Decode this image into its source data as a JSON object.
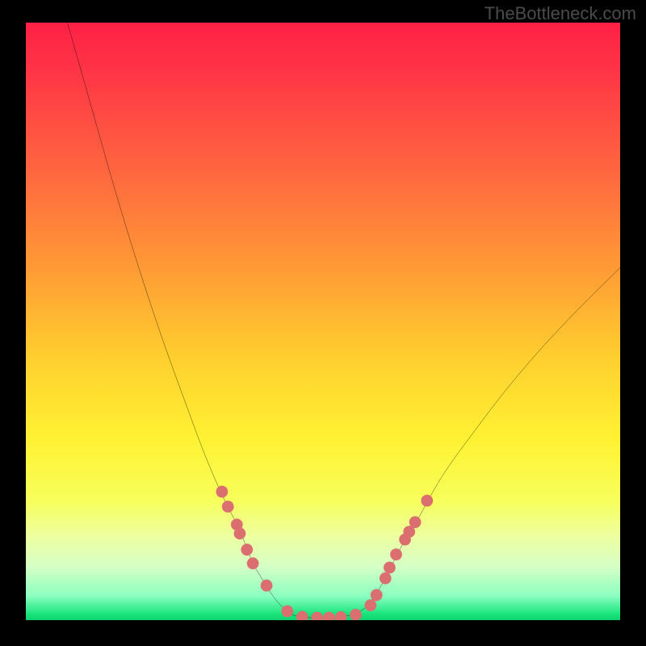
{
  "watermark": "TheBottleneck.com",
  "chart_data": {
    "type": "line",
    "title": "",
    "xlabel": "",
    "ylabel": "",
    "xlim": [
      0,
      100
    ],
    "ylim": [
      0,
      100
    ],
    "grid": false,
    "legend": false,
    "series": [
      {
        "name": "bottleneck-curve",
        "color": "#000000",
        "x": [
          7,
          11,
          15,
          19,
          23,
          27,
          30,
          33,
          36,
          38,
          40,
          42,
          44,
          46,
          50,
          54,
          57,
          59,
          61,
          63,
          66,
          70,
          75,
          82,
          90,
          100
        ],
        "y": [
          100,
          86,
          72,
          59,
          47,
          36,
          28,
          21,
          15,
          10,
          6.5,
          3.5,
          1.5,
          0.6,
          0.4,
          0.7,
          2,
          4.5,
          8,
          12,
          17,
          24,
          31,
          40,
          49,
          59
        ]
      }
    ],
    "markers": [
      {
        "name": "data-dots",
        "color": "#db6e6e",
        "radius": 1.0,
        "points": [
          [
            33,
            21.5
          ],
          [
            34,
            19
          ],
          [
            35.5,
            16
          ],
          [
            36,
            14.5
          ],
          [
            37.2,
            11.8
          ],
          [
            38.2,
            9.5
          ],
          [
            40.5,
            5.8
          ],
          [
            44,
            1.5
          ],
          [
            46.5,
            0.55
          ],
          [
            49,
            0.4
          ],
          [
            51,
            0.4
          ],
          [
            53,
            0.5
          ],
          [
            55.5,
            0.9
          ],
          [
            58,
            2.5
          ],
          [
            59,
            4.2
          ],
          [
            60.5,
            7
          ],
          [
            61.2,
            8.8
          ],
          [
            62.3,
            11
          ],
          [
            63.8,
            13.5
          ],
          [
            64.5,
            14.8
          ],
          [
            65.5,
            16.4
          ],
          [
            67.5,
            20
          ]
        ]
      }
    ],
    "gradient_stops": [
      {
        "pos": 0,
        "color": "#ff2046"
      },
      {
        "pos": 10,
        "color": "#ff3a45"
      },
      {
        "pos": 26,
        "color": "#ff6a3f"
      },
      {
        "pos": 41,
        "color": "#ff9a35"
      },
      {
        "pos": 56,
        "color": "#ffcf2e"
      },
      {
        "pos": 70,
        "color": "#fff233"
      },
      {
        "pos": 80,
        "color": "#f7ff5b"
      },
      {
        "pos": 86,
        "color": "#edffa1"
      },
      {
        "pos": 91,
        "color": "#d6ffc5"
      },
      {
        "pos": 96,
        "color": "#8affc0"
      },
      {
        "pos": 99,
        "color": "#18e47c"
      },
      {
        "pos": 100,
        "color": "#0fd16f"
      }
    ]
  }
}
